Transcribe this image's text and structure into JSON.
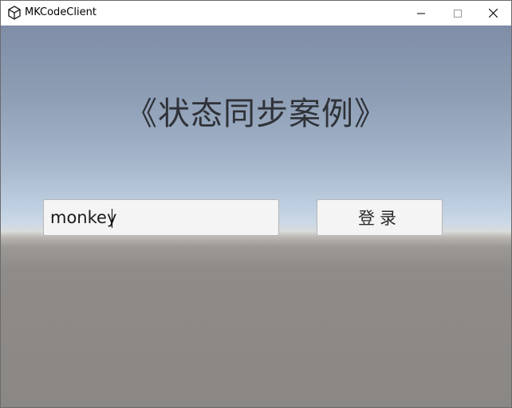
{
  "window": {
    "title": "MKCodeClient",
    "app_icon": "unity-logo-icon",
    "controls": {
      "minimize_icon": "minimize-icon",
      "maximize_icon": "maximize-icon",
      "close_icon": "close-icon"
    }
  },
  "scene": {
    "title": "《状态同步案例》",
    "username_input": {
      "value": "monkey",
      "placeholder": ""
    },
    "login_button": {
      "label": "登录"
    }
  },
  "colors": {
    "sky_top": "#7f8ea6",
    "horizon": "#cdd9e6",
    "ground": "#8b8784",
    "title_text": "#2f3238",
    "input_bg": "#f4f4f4"
  }
}
